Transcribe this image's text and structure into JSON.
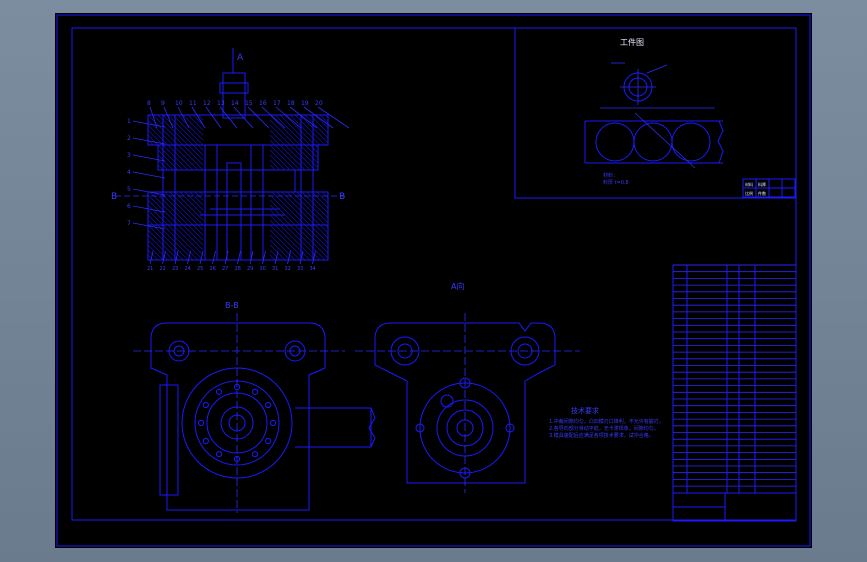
{
  "drawing": {
    "section_label_a": "A",
    "section_label_b_left": "B",
    "section_label_b_right": "B",
    "view_title_bb": "B-B",
    "view_title_aa": "A向",
    "workpiece_title": "工件图",
    "tech_req_title": "技术要求",
    "tech_req_lines": [
      "1.冲裁间隙均匀，凸凹模刃口锋利，不允许有崩刃。",
      "2.各导向部分滑动平稳，无卡滞现象，间隙均匀。",
      "3.模具装配后应满足各项技术要求，试冲合格。"
    ],
    "part_numbers_top": [
      "8",
      "9",
      "10",
      "11",
      "12",
      "13",
      "14",
      "15",
      "16",
      "17",
      "18",
      "19",
      "20"
    ],
    "part_numbers_left": [
      "1",
      "2",
      "3",
      "4",
      "5",
      "6",
      "7"
    ],
    "part_numbers_bottom": [
      "21",
      "22",
      "23",
      "24",
      "25",
      "26",
      "27",
      "28",
      "29",
      "30",
      "31",
      "32",
      "33",
      "34"
    ],
    "workpiece_note_1": "材料：",
    "workpiece_note_2": "料厚 t=0.8",
    "small_block": [
      "材料",
      "料厚",
      "比例",
      "件数"
    ],
    "colors": {
      "background": "#000000",
      "line": "#1a1aff",
      "frame": "#6f7f92"
    }
  }
}
